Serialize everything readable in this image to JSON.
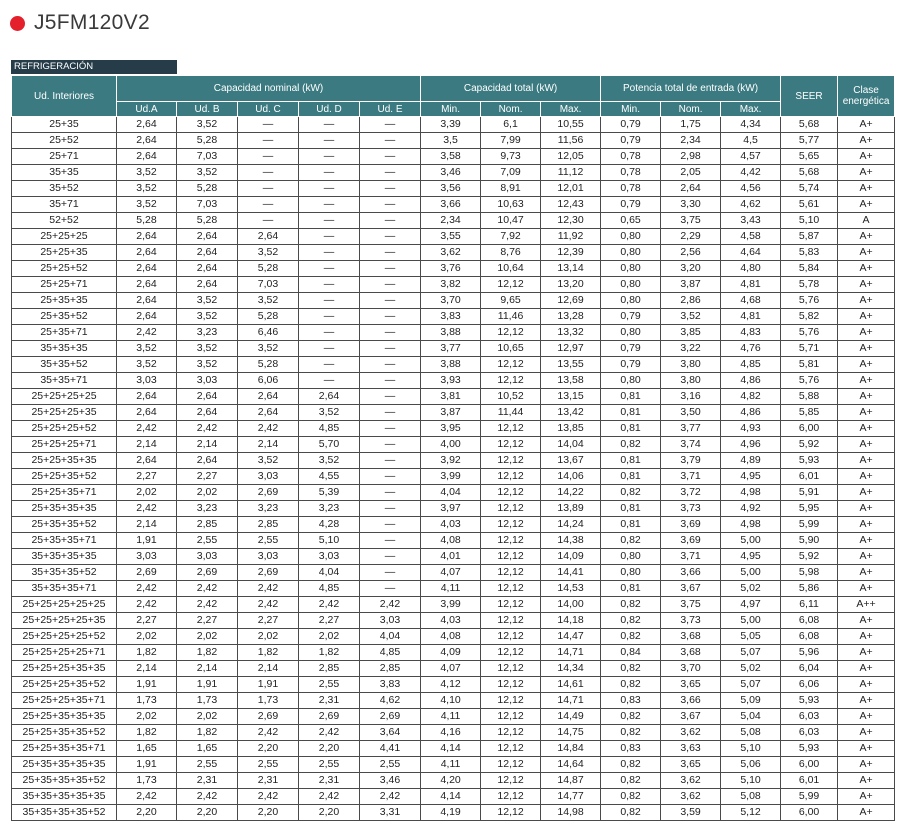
{
  "title": "J5FM120V2",
  "section": "REFRIGERACIÓN",
  "headers": {
    "ud_interiores": "Ud. Interiores",
    "capacidad_nominal": "Capacidad nominal (kW)",
    "capacidad_total": "Capacidad total (kW)",
    "potencia_total": "Potencia total de entrada (kW)",
    "seer": "SEER",
    "clase": "Clase energética",
    "sub": [
      "Ud.A",
      "Ud. B",
      "Ud. C",
      "Ud. D",
      "Ud. E",
      "Min.",
      "Nom.",
      "Max.",
      "Min.",
      "Nom.",
      "Max."
    ]
  },
  "rows": [
    [
      "25+35",
      "2,64",
      "3,52",
      "—",
      "—",
      "—",
      "3,39",
      "6,1",
      "10,55",
      "0,79",
      "1,75",
      "4,34",
      "5,68",
      "A+"
    ],
    [
      "25+52",
      "2,64",
      "5,28",
      "—",
      "—",
      "—",
      "3,5",
      "7,99",
      "11,56",
      "0,79",
      "2,34",
      "4,5",
      "5,77",
      "A+"
    ],
    [
      "25+71",
      "2,64",
      "7,03",
      "—",
      "—",
      "—",
      "3,58",
      "9,73",
      "12,05",
      "0,78",
      "2,98",
      "4,57",
      "5,65",
      "A+"
    ],
    [
      "35+35",
      "3,52",
      "3,52",
      "—",
      "—",
      "—",
      "3,46",
      "7,09",
      "11,12",
      "0,78",
      "2,05",
      "4,42",
      "5,68",
      "A+"
    ],
    [
      "35+52",
      "3,52",
      "5,28",
      "—",
      "—",
      "—",
      "3,56",
      "8,91",
      "12,01",
      "0,78",
      "2,64",
      "4,56",
      "5,74",
      "A+"
    ],
    [
      "35+71",
      "3,52",
      "7,03",
      "—",
      "—",
      "—",
      "3,66",
      "10,63",
      "12,43",
      "0,79",
      "3,30",
      "4,62",
      "5,61",
      "A+"
    ],
    [
      "52+52",
      "5,28",
      "5,28",
      "—",
      "—",
      "—",
      "2,34",
      "10,47",
      "12,30",
      "0,65",
      "3,75",
      "3,43",
      "5,10",
      "A"
    ],
    [
      "25+25+25",
      "2,64",
      "2,64",
      "2,64",
      "—",
      "—",
      "3,55",
      "7,92",
      "11,92",
      "0,80",
      "2,29",
      "4,58",
      "5,87",
      "A+"
    ],
    [
      "25+25+35",
      "2,64",
      "2,64",
      "3,52",
      "—",
      "—",
      "3,62",
      "8,76",
      "12,39",
      "0,80",
      "2,56",
      "4,64",
      "5,83",
      "A+"
    ],
    [
      "25+25+52",
      "2,64",
      "2,64",
      "5,28",
      "—",
      "—",
      "3,76",
      "10,64",
      "13,14",
      "0,80",
      "3,20",
      "4,80",
      "5,84",
      "A+"
    ],
    [
      "25+25+71",
      "2,64",
      "2,64",
      "7,03",
      "—",
      "—",
      "3,82",
      "12,12",
      "13,20",
      "0,80",
      "3,87",
      "4,81",
      "5,78",
      "A+"
    ],
    [
      "25+35+35",
      "2,64",
      "3,52",
      "3,52",
      "—",
      "—",
      "3,70",
      "9,65",
      "12,69",
      "0,80",
      "2,86",
      "4,68",
      "5,76",
      "A+"
    ],
    [
      "25+35+52",
      "2,64",
      "3,52",
      "5,28",
      "—",
      "—",
      "3,83",
      "11,46",
      "13,28",
      "0,79",
      "3,52",
      "4,81",
      "5,82",
      "A+"
    ],
    [
      "25+35+71",
      "2,42",
      "3,23",
      "6,46",
      "—",
      "—",
      "3,88",
      "12,12",
      "13,32",
      "0,80",
      "3,85",
      "4,83",
      "5,76",
      "A+"
    ],
    [
      "35+35+35",
      "3,52",
      "3,52",
      "3,52",
      "—",
      "—",
      "3,77",
      "10,65",
      "12,97",
      "0,79",
      "3,22",
      "4,76",
      "5,71",
      "A+"
    ],
    [
      "35+35+52",
      "3,52",
      "3,52",
      "5,28",
      "—",
      "—",
      "3,88",
      "12,12",
      "13,55",
      "0,79",
      "3,80",
      "4,85",
      "5,81",
      "A+"
    ],
    [
      "35+35+71",
      "3,03",
      "3,03",
      "6,06",
      "—",
      "—",
      "3,93",
      "12,12",
      "13,58",
      "0,80",
      "3,80",
      "4,86",
      "5,76",
      "A+"
    ],
    [
      "25+25+25+25",
      "2,64",
      "2,64",
      "2,64",
      "2,64",
      "—",
      "3,81",
      "10,52",
      "13,15",
      "0,81",
      "3,16",
      "4,82",
      "5,88",
      "A+"
    ],
    [
      "25+25+25+35",
      "2,64",
      "2,64",
      "2,64",
      "3,52",
      "—",
      "3,87",
      "11,44",
      "13,42",
      "0,81",
      "3,50",
      "4,86",
      "5,85",
      "A+"
    ],
    [
      "25+25+25+52",
      "2,42",
      "2,42",
      "2,42",
      "4,85",
      "—",
      "3,95",
      "12,12",
      "13,85",
      "0,81",
      "3,77",
      "4,93",
      "6,00",
      "A+"
    ],
    [
      "25+25+25+71",
      "2,14",
      "2,14",
      "2,14",
      "5,70",
      "—",
      "4,00",
      "12,12",
      "14,04",
      "0,82",
      "3,74",
      "4,96",
      "5,92",
      "A+"
    ],
    [
      "25+25+35+35",
      "2,64",
      "2,64",
      "3,52",
      "3,52",
      "—",
      "3,92",
      "12,12",
      "13,67",
      "0,81",
      "3,79",
      "4,89",
      "5,93",
      "A+"
    ],
    [
      "25+25+35+52",
      "2,27",
      "2,27",
      "3,03",
      "4,55",
      "—",
      "3,99",
      "12,12",
      "14,06",
      "0,81",
      "3,71",
      "4,95",
      "6,01",
      "A+"
    ],
    [
      "25+25+35+71",
      "2,02",
      "2,02",
      "2,69",
      "5,39",
      "—",
      "4,04",
      "12,12",
      "14,22",
      "0,82",
      "3,72",
      "4,98",
      "5,91",
      "A+"
    ],
    [
      "25+35+35+35",
      "2,42",
      "3,23",
      "3,23",
      "3,23",
      "—",
      "3,97",
      "12,12",
      "13,89",
      "0,81",
      "3,73",
      "4,92",
      "5,95",
      "A+"
    ],
    [
      "25+35+35+52",
      "2,14",
      "2,85",
      "2,85",
      "4,28",
      "—",
      "4,03",
      "12,12",
      "14,24",
      "0,81",
      "3,69",
      "4,98",
      "5,99",
      "A+"
    ],
    [
      "25+35+35+71",
      "1,91",
      "2,55",
      "2,55",
      "5,10",
      "—",
      "4,08",
      "12,12",
      "14,38",
      "0,82",
      "3,69",
      "5,00",
      "5,90",
      "A+"
    ],
    [
      "35+35+35+35",
      "3,03",
      "3,03",
      "3,03",
      "3,03",
      "—",
      "4,01",
      "12,12",
      "14,09",
      "0,80",
      "3,71",
      "4,95",
      "5,92",
      "A+"
    ],
    [
      "35+35+35+52",
      "2,69",
      "2,69",
      "2,69",
      "4,04",
      "—",
      "4,07",
      "12,12",
      "14,41",
      "0,80",
      "3,66",
      "5,00",
      "5,98",
      "A+"
    ],
    [
      "35+35+35+71",
      "2,42",
      "2,42",
      "2,42",
      "4,85",
      "—",
      "4,11",
      "12,12",
      "14,53",
      "0,81",
      "3,67",
      "5,02",
      "5,86",
      "A+"
    ],
    [
      "25+25+25+25+25",
      "2,42",
      "2,42",
      "2,42",
      "2,42",
      "2,42",
      "3,99",
      "12,12",
      "14,00",
      "0,82",
      "3,75",
      "4,97",
      "6,11",
      "A++"
    ],
    [
      "25+25+25+25+35",
      "2,27",
      "2,27",
      "2,27",
      "2,27",
      "3,03",
      "4,03",
      "12,12",
      "14,18",
      "0,82",
      "3,73",
      "5,00",
      "6,08",
      "A+"
    ],
    [
      "25+25+25+25+52",
      "2,02",
      "2,02",
      "2,02",
      "2,02",
      "4,04",
      "4,08",
      "12,12",
      "14,47",
      "0,82",
      "3,68",
      "5,05",
      "6,08",
      "A+"
    ],
    [
      "25+25+25+25+71",
      "1,82",
      "1,82",
      "1,82",
      "1,82",
      "4,85",
      "4,09",
      "12,12",
      "14,71",
      "0,84",
      "3,68",
      "5,07",
      "5,96",
      "A+"
    ],
    [
      "25+25+25+35+35",
      "2,14",
      "2,14",
      "2,14",
      "2,85",
      "2,85",
      "4,07",
      "12,12",
      "14,34",
      "0,82",
      "3,70",
      "5,02",
      "6,04",
      "A+"
    ],
    [
      "25+25+25+35+52",
      "1,91",
      "1,91",
      "1,91",
      "2,55",
      "3,83",
      "4,12",
      "12,12",
      "14,61",
      "0,82",
      "3,65",
      "5,07",
      "6,06",
      "A+"
    ],
    [
      "25+25+25+35+71",
      "1,73",
      "1,73",
      "1,73",
      "2,31",
      "4,62",
      "4,10",
      "12,12",
      "14,71",
      "0,83",
      "3,66",
      "5,09",
      "5,93",
      "A+"
    ],
    [
      "25+25+35+35+35",
      "2,02",
      "2,02",
      "2,69",
      "2,69",
      "2,69",
      "4,11",
      "12,12",
      "14,49",
      "0,82",
      "3,67",
      "5,04",
      "6,03",
      "A+"
    ],
    [
      "25+25+35+35+52",
      "1,82",
      "1,82",
      "2,42",
      "2,42",
      "3,64",
      "4,16",
      "12,12",
      "14,75",
      "0,82",
      "3,62",
      "5,08",
      "6,03",
      "A+"
    ],
    [
      "25+25+35+35+71",
      "1,65",
      "1,65",
      "2,20",
      "2,20",
      "4,41",
      "4,14",
      "12,12",
      "14,84",
      "0,83",
      "3,63",
      "5,10",
      "5,93",
      "A+"
    ],
    [
      "25+35+35+35+35",
      "1,91",
      "2,55",
      "2,55",
      "2,55",
      "2,55",
      "4,11",
      "12,12",
      "14,64",
      "0,82",
      "3,65",
      "5,06",
      "6,00",
      "A+"
    ],
    [
      "25+35+35+35+52",
      "1,73",
      "2,31",
      "2,31",
      "2,31",
      "3,46",
      "4,20",
      "12,12",
      "14,87",
      "0,82",
      "3,62",
      "5,10",
      "6,01",
      "A+"
    ],
    [
      "35+35+35+35+35",
      "2,42",
      "2,42",
      "2,42",
      "2,42",
      "2,42",
      "4,14",
      "12,12",
      "14,77",
      "0,82",
      "3,62",
      "5,08",
      "5,99",
      "A+"
    ],
    [
      "35+35+35+35+52",
      "2,20",
      "2,20",
      "2,20",
      "2,20",
      "3,31",
      "4,19",
      "12,12",
      "14,98",
      "0,82",
      "3,59",
      "5,12",
      "6,00",
      "A+"
    ]
  ]
}
